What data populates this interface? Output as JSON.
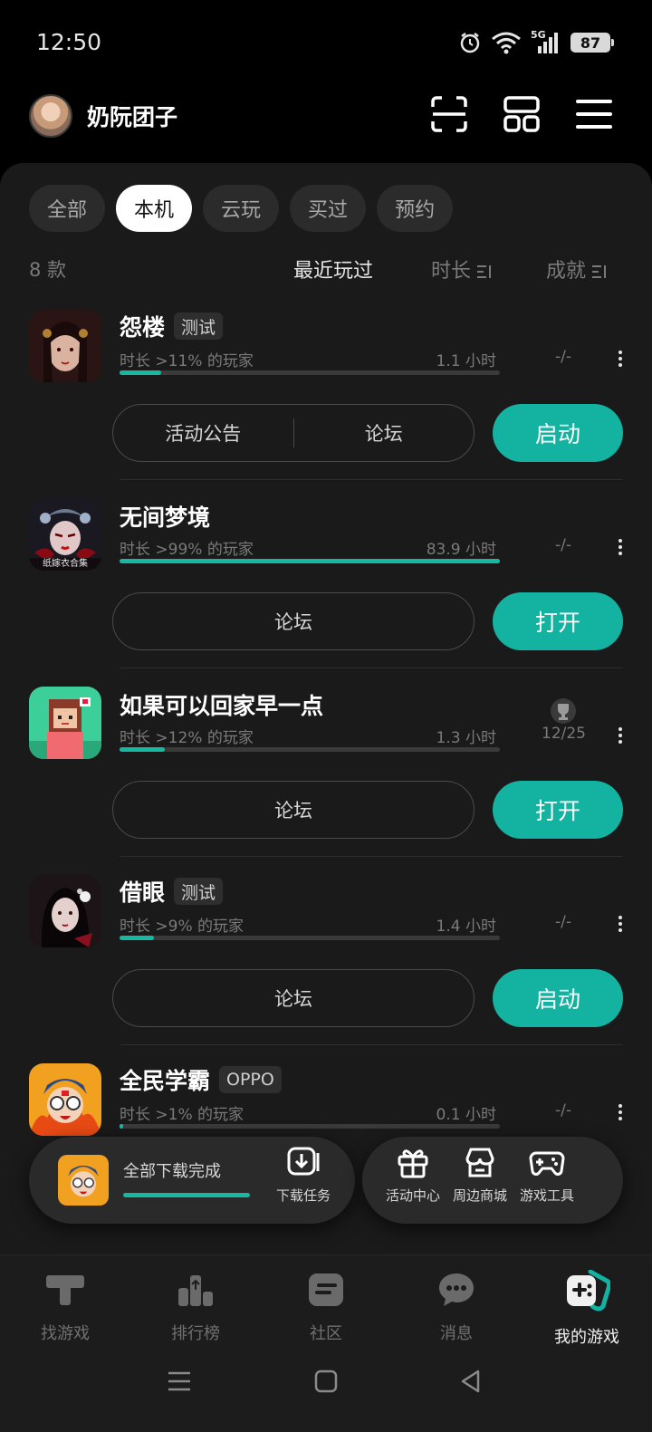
{
  "status_bar": {
    "time": "12:50",
    "network": "5G",
    "battery": "87"
  },
  "header": {
    "username": "奶阮团子"
  },
  "tabs": [
    {
      "label": "全部",
      "active": false
    },
    {
      "label": "本机",
      "active": true
    },
    {
      "label": "云玩",
      "active": false
    },
    {
      "label": "买过",
      "active": false
    },
    {
      "label": "预约",
      "active": false
    }
  ],
  "sort_bar": {
    "count": "8 款",
    "recent": "最近玩过",
    "time": "时长",
    "achievement": "成就"
  },
  "games": [
    {
      "title": "怨楼",
      "tag": "测试",
      "subtitle": "时长 >11% 的玩家",
      "hours": "1.1 小时",
      "progress": 0.11,
      "achievement": "-/-",
      "secondary": [
        "活动公告",
        "论坛"
      ],
      "primary": "启动"
    },
    {
      "title": "无间梦境",
      "tag": "",
      "subtitle": "时长 >99% 的玩家",
      "hours": "83.9 小时",
      "progress": 1.0,
      "achievement": "-/-",
      "secondary": [
        "论坛"
      ],
      "primary": "打开",
      "icon_text": "纸嫁衣合集"
    },
    {
      "title": "如果可以回家早一点",
      "tag": "",
      "subtitle": "时长 >12% 的玩家",
      "hours": "1.3 小时",
      "progress": 0.12,
      "achievement": "12/25",
      "secondary": [
        "论坛"
      ],
      "primary": "打开"
    },
    {
      "title": "借眼",
      "tag": "测试",
      "subtitle": "时长 >9% 的玩家",
      "hours": "1.4 小时",
      "progress": 0.09,
      "achievement": "-/-",
      "secondary": [
        "论坛"
      ],
      "primary": "启动"
    },
    {
      "title": "全民学霸",
      "tag": "OPPO",
      "subtitle": "时长 >1% 的玩家",
      "hours": "0.1 小时",
      "progress": 0.01,
      "achievement": "-/-"
    }
  ],
  "download": {
    "status": "全部下载完成",
    "task_label": "下载任务",
    "progress": 1.0
  },
  "actions": [
    {
      "label": "活动中心",
      "icon": "gift-icon"
    },
    {
      "label": "周边商城",
      "icon": "shop-icon"
    },
    {
      "label": "游戏工具",
      "icon": "gamepad-icon"
    }
  ],
  "bottom_nav": [
    {
      "label": "找游戏",
      "icon": "discover-icon",
      "active": false
    },
    {
      "label": "排行榜",
      "icon": "ranking-icon",
      "active": false
    },
    {
      "label": "社区",
      "icon": "community-icon",
      "active": false
    },
    {
      "label": "消息",
      "icon": "message-icon",
      "active": false
    },
    {
      "label": "我的游戏",
      "icon": "my-games-icon",
      "active": true
    }
  ],
  "colors": {
    "accent": "#14b3a1",
    "background": "#1a1a1a",
    "tab_active": "#ffffff"
  }
}
